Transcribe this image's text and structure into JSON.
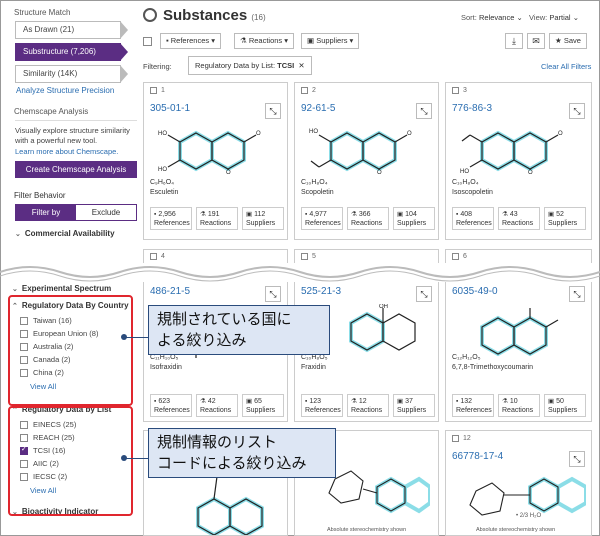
{
  "sidebar": {
    "structure_match_heading": "Structure Match",
    "structure_match": [
      {
        "label": "As Drawn (21)",
        "active": false
      },
      {
        "label": "Substructure (7,206)",
        "active": true
      },
      {
        "label": "Similarity (14K)",
        "active": false
      }
    ],
    "analyze_link": "Analyze Structure Precision",
    "chemscape_heading": "Chemscape Analysis",
    "chemscape_text": "Visually explore structure similarity with a powerful new tool.",
    "chemscape_link": "Learn more about Chemscape.",
    "chemscape_button": "Create Chemscape Analysis",
    "filter_behavior_heading": "Filter Behavior",
    "filter_by": "Filter by",
    "exclude": "Exclude",
    "commercial_availability": "Commercial Availability",
    "experimental_spectrum": "Experimental Spectrum",
    "regulatory_country_heading": "Regulatory Data By Country",
    "countries": [
      {
        "label": "Taiwan (16)",
        "checked": false
      },
      {
        "label": "European Union (8)",
        "checked": false
      },
      {
        "label": "Australia (2)",
        "checked": false
      },
      {
        "label": "Canada (2)",
        "checked": false
      },
      {
        "label": "China (2)",
        "checked": false
      }
    ],
    "view_all": "View All",
    "regulatory_list_heading": "Regulatory Data by List",
    "lists": [
      {
        "label": "EINECS (25)",
        "checked": false
      },
      {
        "label": "REACH (25)",
        "checked": false
      },
      {
        "label": "TCSI (16)",
        "checked": true
      },
      {
        "label": "AIIC (2)",
        "checked": false
      },
      {
        "label": "IECSC (2)",
        "checked": false
      }
    ],
    "bioactivity": "Bioactivity Indicator"
  },
  "header": {
    "title": "Substances",
    "count": "(16)",
    "sort_label": "Sort:",
    "sort_value": "Relevance",
    "view_label": "View:",
    "view_value": "Partial"
  },
  "toolbar": {
    "references": "References",
    "reactions": "Reactions",
    "suppliers": "Suppliers",
    "save": "Save"
  },
  "filter_bar": {
    "label": "Filtering:",
    "chip_text": "Regulatory Data by List:",
    "chip_value": "TCSI",
    "clear_all": "Clear All Filters"
  },
  "cards": [
    {
      "num": "1",
      "cas": "305-01-1",
      "formula": "C₉H₆O₄",
      "name": "Esculetin",
      "refs": "2,956",
      "rxns": "191",
      "sups": "112"
    },
    {
      "num": "2",
      "cas": "92-61-5",
      "formula": "C₁₀H₈O₄",
      "name": "Scopoletin",
      "refs": "4,977",
      "rxns": "366",
      "sups": "104"
    },
    {
      "num": "3",
      "cas": "776-86-3",
      "formula": "C₁₀H₈O₄",
      "name": "Isoscopoletin",
      "refs": "408",
      "rxns": "43",
      "sups": "52"
    },
    {
      "num": "4",
      "cas": "486-21-5",
      "formula": "C₁₁H₁₀O₅",
      "name": "Isofraxidin",
      "refs": "623",
      "rxns": "42",
      "sups": "65"
    },
    {
      "num": "5",
      "cas": "525-21-3",
      "formula": "C₁₀H₈O₅",
      "name": "Fraxidin",
      "refs": "123",
      "rxns": "12",
      "sups": "37"
    },
    {
      "num": "6",
      "cas": "6035-49-0",
      "formula": "C₁₂H₁₂O₅",
      "name": "6,7,8-Trimethoxycoumarin",
      "refs": "132",
      "rxns": "10",
      "sups": "50"
    },
    {
      "num": "12",
      "cas": "66778-17-4"
    }
  ],
  "stat_labels": {
    "refs": "References",
    "rxns": "Reactions",
    "sups": "Suppliers"
  },
  "abs_stereo": "Absolute stereochemistry shown",
  "h2o_label": "• 2/3 H₂O",
  "callouts": {
    "country": [
      "規制されている国に",
      "よる絞り込み"
    ],
    "list": [
      "規制情報のリスト",
      "コードによる絞り込み"
    ]
  },
  "colors": {
    "brand": "#5b2d83",
    "link": "#2a6db0",
    "highlight": "#3fc8d8",
    "annotation": "#e0262e"
  }
}
